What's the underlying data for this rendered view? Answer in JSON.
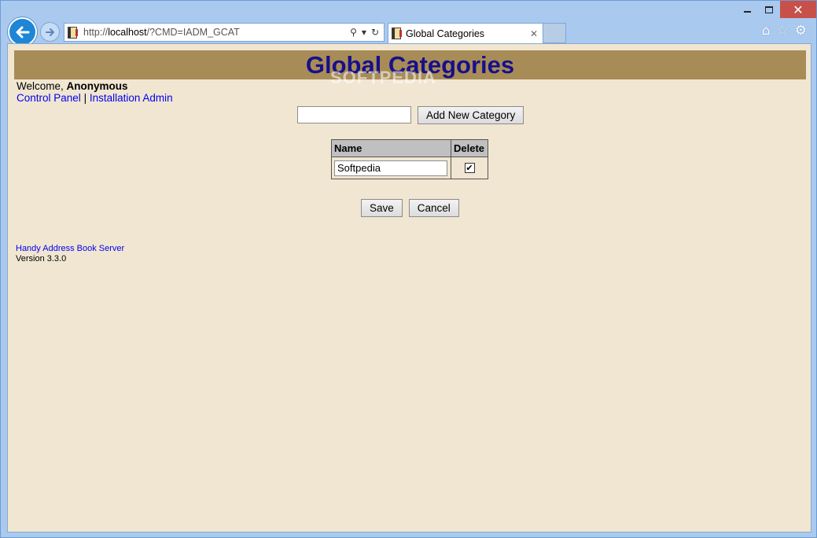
{
  "browser": {
    "url_prefix": "http://",
    "url_host": "localhost",
    "url_path": "/?CMD=IADM_GCAT",
    "tab_title": "Global Categories",
    "accent_color": "#1d86d6"
  },
  "page": {
    "header_title": "Global Categories",
    "watermark": "SOFTPEDIA",
    "welcome_prefix": "Welcome, ",
    "welcome_user": "Anonymous",
    "link_control_panel": "Control Panel",
    "link_separator": " | ",
    "link_install_admin": "Installation Admin",
    "new_category_value": "",
    "add_button": "Add New Category",
    "table": {
      "columns": [
        "Name",
        "Delete"
      ],
      "rows": [
        {
          "name": "Softpedia",
          "delete_checked": true
        }
      ]
    },
    "save_button": "Save",
    "cancel_button": "Cancel",
    "footer_app": "Handy Address Book Server",
    "footer_version": "Version 3.3.0"
  }
}
